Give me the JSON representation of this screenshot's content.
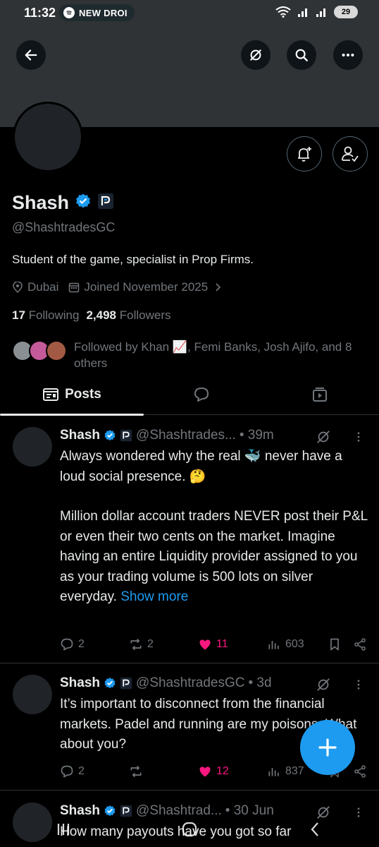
{
  "status_bar": {
    "time": "11:32",
    "media_label": "NEW DROI",
    "battery": "29"
  },
  "profile": {
    "name": "Shash",
    "handle": "@ShashtradesGC",
    "bio": "Student of the game, specialist in Prop Firms.",
    "location": "Dubai",
    "joined": "Joined November 2025",
    "following_count": "17",
    "following_label": "Following",
    "followers_count": "2,498",
    "followers_label": "Followers",
    "followed_by": "Followed by Khan 📈, Femi Banks, Josh Ajifo, and 8 others"
  },
  "tabs": [
    {
      "label": "Posts",
      "selected": true
    },
    {
      "label": "",
      "icon": "chat-bubble-icon"
    },
    {
      "label": "",
      "icon": "media-icon"
    }
  ],
  "posts": [
    {
      "name": "Shash",
      "handle": "@Shashtrades...",
      "time": "• 39m",
      "paragraph1": "Always wondered why the real 🐳 never have a loud social presence. 🤔",
      "paragraph2": "Million dollar account traders NEVER post their P&L or even their two cents on the market. Imagine having an entire Liquidity provider assigned to you as your trading volume is 500 lots on silver everyday.",
      "show_more": "Show more",
      "replies": "2",
      "reposts": "2",
      "likes": "11",
      "views": "603"
    },
    {
      "name": "Shash",
      "handle": "@ShashtradesGC",
      "time": "• 3d",
      "paragraph1": "It’s important to disconnect from the financial markets. Padel and running are my poisons. What about you?",
      "replies": "2",
      "reposts": "",
      "likes": "12",
      "views": "837"
    },
    {
      "name": "Shash",
      "handle": "@Shashtrad...",
      "time": "• 30 Jun",
      "paragraph1": "How many payouts have you got so far"
    }
  ],
  "colors": {
    "accent": "#1d9bf0",
    "like": "#f91880",
    "banner": "#2f3336"
  }
}
